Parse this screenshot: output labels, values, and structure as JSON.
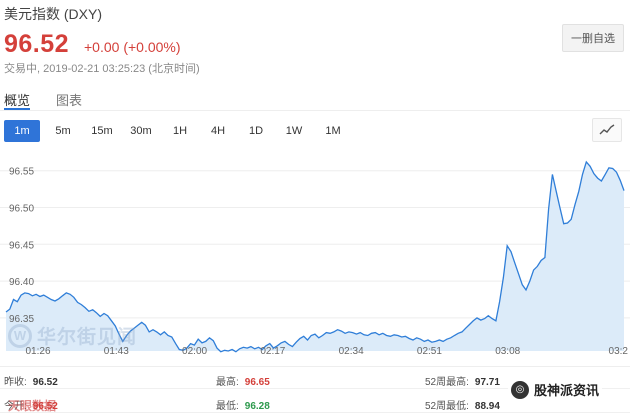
{
  "header": {
    "title": "美元指数 (DXY)",
    "price": "96.52",
    "change": "+0.00 (+0.00%)",
    "status": "交易中, 2019-02-21 03:25:23 (北京时间)",
    "watch_button": "一删自选"
  },
  "tabs": [
    {
      "label": "概览",
      "active": true
    },
    {
      "label": "图表",
      "active": false
    }
  ],
  "periods": [
    {
      "label": "1m",
      "active": true
    },
    {
      "label": "5m",
      "active": false
    },
    {
      "label": "15m",
      "active": false
    },
    {
      "label": "30m",
      "active": false
    },
    {
      "label": "1H",
      "active": false
    },
    {
      "label": "4H",
      "active": false
    },
    {
      "label": "1D",
      "active": false
    },
    {
      "label": "1W",
      "active": false
    },
    {
      "label": "1M",
      "active": false
    }
  ],
  "chart_type_icon": "line-chart-icon",
  "chart_data": {
    "type": "area",
    "title": "",
    "xlabel": "",
    "ylabel": "",
    "x_ticks": [
      "01:26",
      "01:43",
      "02:00",
      "02:17",
      "02:34",
      "02:51",
      "03:08",
      "03:2"
    ],
    "y_ticks": [
      "96.55",
      "96.50",
      "96.45",
      "96.40",
      "96.35"
    ],
    "ylim": [
      96.305,
      96.57
    ],
    "series": [
      {
        "line_color": "#2f7ed8",
        "fill_color": "#dcebf9",
        "values": [
          96.358,
          96.362,
          96.375,
          96.372,
          96.381,
          96.384,
          96.383,
          96.38,
          96.382,
          96.379,
          96.381,
          96.378,
          96.375,
          96.373,
          96.376,
          96.38,
          96.384,
          96.382,
          96.378,
          96.371,
          96.368,
          96.364,
          96.359,
          96.361,
          96.357,
          96.352,
          96.356,
          96.353,
          96.346,
          96.339,
          96.328,
          96.318,
          96.326,
          96.332,
          96.336,
          96.34,
          96.344,
          96.34,
          96.331,
          96.334,
          96.331,
          96.327,
          96.331,
          96.326,
          96.324,
          96.315,
          96.307,
          96.306,
          96.309,
          96.315,
          96.313,
          96.321,
          96.316,
          96.318,
          96.323,
          96.319,
          96.309,
          96.304,
          96.306,
          96.305,
          96.307,
          96.304,
          96.308,
          96.31,
          96.309,
          96.311,
          96.308,
          96.31,
          96.307,
          96.312,
          96.315,
          96.309,
          96.312,
          96.316,
          96.318,
          96.314,
          96.311,
          96.317,
          96.322,
          96.325,
          96.32,
          96.326,
          96.328,
          96.323,
          96.326,
          96.33,
          96.329,
          96.331,
          96.334,
          96.332,
          96.329,
          96.331,
          96.33,
          96.328,
          96.33,
          96.327,
          96.326,
          96.329,
          96.33,
          96.327,
          96.329,
          96.326,
          96.325,
          96.327,
          96.326,
          96.324,
          96.325,
          96.322,
          96.32,
          96.323,
          96.321,
          96.318,
          96.32,
          96.317,
          96.318,
          96.32,
          96.318,
          96.321,
          96.323,
          96.326,
          96.329,
          96.331,
          96.336,
          96.341,
          96.346,
          96.35,
          96.347,
          96.349,
          96.353,
          96.349,
          96.346,
          96.372,
          96.405,
          96.448,
          96.44,
          96.425,
          96.41,
          96.395,
          96.388,
          96.4,
          96.415,
          96.42,
          96.428,
          96.432,
          96.498,
          96.545,
          96.522,
          96.5,
          96.478,
          96.479,
          96.484,
          96.504,
          96.522,
          96.545,
          96.562,
          96.556,
          96.546,
          96.54,
          96.536,
          96.545,
          96.554,
          96.553,
          96.548,
          96.537,
          96.523
        ]
      }
    ],
    "grid": true
  },
  "watermark": {
    "text": "华尔街见闻",
    "mark": "W"
  },
  "stats": {
    "row1": [
      {
        "label": "昨收:",
        "value": "96.52",
        "tone": "dark"
      },
      {
        "label": "最高:",
        "value": "96.65",
        "tone": "red"
      },
      {
        "label": "52周最高:",
        "value": "97.71",
        "tone": "dark"
      }
    ],
    "row2": [
      {
        "label": "今开:",
        "value": "96.52",
        "tone": "red"
      },
      {
        "label": "最低:",
        "value": "96.28",
        "tone": "green"
      },
      {
        "label": "52周最低:",
        "value": "88.94",
        "tone": "dark"
      }
    ]
  },
  "badge": {
    "text": "股神派资讯"
  },
  "bottom_logo": {
    "text": "天眼数据"
  }
}
